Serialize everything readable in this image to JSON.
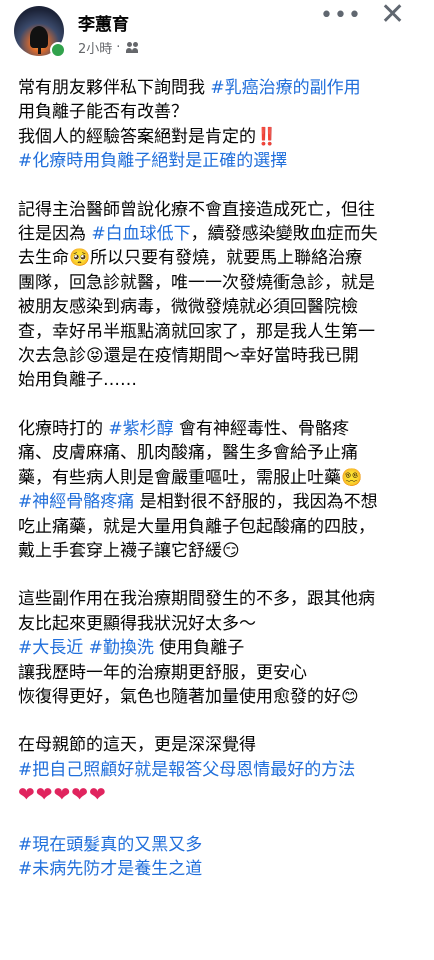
{
  "post": {
    "author": "李蕙育",
    "time": "2小時",
    "separator": "·",
    "more_label": "•••",
    "close_label": "✕"
  },
  "paragraphs": [
    [
      {
        "t": "常有朋友夥伴私下詢問我 ",
        "c": "text"
      },
      {
        "t": "#乳癌治療的副作用",
        "c": "tag"
      },
      {
        "br": true
      },
      {
        "t": "用負離子能否有改善？",
        "c": "text"
      },
      {
        "br": true
      },
      {
        "t": "我個人的經驗答案絕對是肯定的",
        "c": "text"
      },
      {
        "t": "‼️",
        "c": "bang"
      },
      {
        "br": true
      },
      {
        "t": "#化療時用負離子絕對是正確的選擇",
        "c": "tag"
      }
    ],
    [
      {
        "t": "記得主治醫師曾說化療不會直接造成死亡，但往",
        "c": "text"
      },
      {
        "br": true
      },
      {
        "t": "往是因為 ",
        "c": "text"
      },
      {
        "t": "#白血球低下",
        "c": "tag"
      },
      {
        "t": "，續發感染變敗血症而失",
        "c": "text"
      },
      {
        "br": true
      },
      {
        "t": "去生命",
        "c": "text"
      },
      {
        "t": "🥺",
        "c": "emoji"
      },
      {
        "t": "所以只要有發燒，就要馬上聯絡治療",
        "c": "text"
      },
      {
        "br": true
      },
      {
        "t": "團隊，回急診就醫，唯一一次發燒衝急診，就是",
        "c": "text"
      },
      {
        "br": true
      },
      {
        "t": "被朋友感染到病毒，微微發燒就必須回醫院檢",
        "c": "text"
      },
      {
        "br": true
      },
      {
        "t": "查，幸好吊半瓶點滴就回家了，那是我人生第一",
        "c": "text"
      },
      {
        "br": true
      },
      {
        "t": "次去急診",
        "c": "text"
      },
      {
        "t": "😝",
        "c": "emoji"
      },
      {
        "t": "還是在疫情期間～幸好當時我已開",
        "c": "text"
      },
      {
        "br": true
      },
      {
        "t": "始用負離子……",
        "c": "text"
      }
    ],
    [
      {
        "t": "化療時打的 ",
        "c": "text"
      },
      {
        "t": "#紫杉醇",
        "c": "tag"
      },
      {
        "t": " 會有神經毒性、骨骼疼",
        "c": "text"
      },
      {
        "br": true
      },
      {
        "t": "痛、皮膚麻痛、肌肉酸痛，醫生多會給予止痛",
        "c": "text"
      },
      {
        "br": true
      },
      {
        "t": "藥，有些病人則是會嚴重嘔吐，需服止吐藥",
        "c": "text"
      },
      {
        "t": "😵‍💫",
        "c": "emoji"
      },
      {
        "br": true
      },
      {
        "t": "#神經骨骼疼痛",
        "c": "tag"
      },
      {
        "t": " 是相對很不舒服的，我因為不想",
        "c": "text"
      },
      {
        "br": true
      },
      {
        "t": "吃止痛藥，就是大量用負離子包起酸痛的四肢，",
        "c": "text"
      },
      {
        "br": true
      },
      {
        "t": "戴上手套穿上襪子讓它舒緩",
        "c": "text"
      },
      {
        "t": "😏",
        "c": "emoji"
      }
    ],
    [
      {
        "t": "這些副作用在我治療期間發生的不多，跟其他病",
        "c": "text"
      },
      {
        "br": true
      },
      {
        "t": "友比起來更顯得我狀況好太多～",
        "c": "text"
      },
      {
        "br": true
      },
      {
        "t": "#大長近",
        "c": "tag"
      },
      {
        "t": " ",
        "c": "text"
      },
      {
        "t": "#勤換洗",
        "c": "tag"
      },
      {
        "t": " 使用負離子",
        "c": "text"
      },
      {
        "br": true
      },
      {
        "t": "讓我歷時一年的治療期更舒服，更安心",
        "c": "text"
      },
      {
        "br": true
      },
      {
        "t": "恢復得更好，氣色也隨著加量使用愈發的好",
        "c": "text"
      },
      {
        "t": "😊",
        "c": "emoji"
      }
    ],
    [
      {
        "t": "在母親節的這天，更是深深覺得",
        "c": "text"
      },
      {
        "br": true
      },
      {
        "t": "#把自己照顧好就是報答父母恩情最好的方法",
        "c": "tag"
      },
      {
        "br": true
      },
      {
        "t": "❤❤❤❤❤",
        "c": "hearts"
      }
    ],
    [
      {
        "t": "#現在頭髮真的又黑又多",
        "c": "tag"
      },
      {
        "br": true
      },
      {
        "t": "#未病先防才是養生之道",
        "c": "tag"
      }
    ]
  ]
}
